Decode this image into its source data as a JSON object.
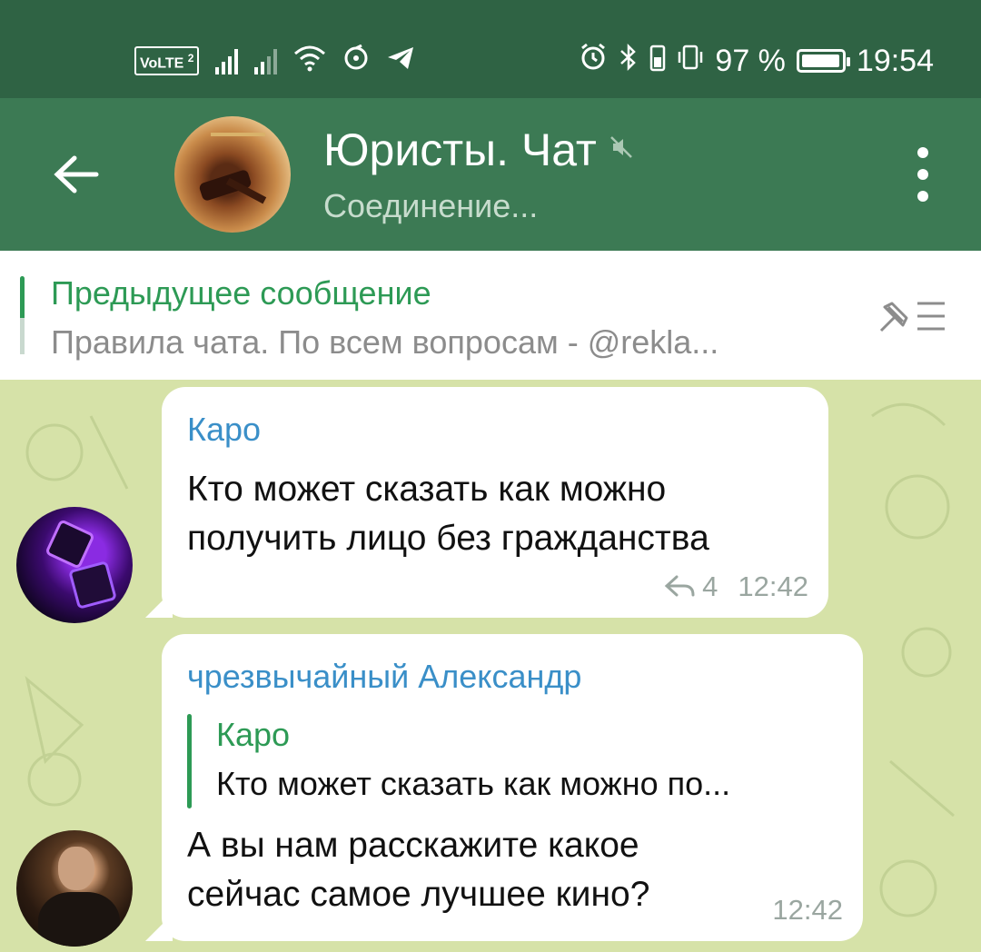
{
  "status_bar": {
    "volte_label": "VoLTE",
    "sim_number": "2",
    "battery_percent_label": "97 %",
    "battery_level": 0.97,
    "time": "19:54",
    "icons": [
      "signal-icon",
      "wifi-icon",
      "sync-icon",
      "telegram-icon",
      "alarm-icon",
      "bluetooth-icon",
      "vibrate-icon",
      "battery-icon"
    ]
  },
  "header": {
    "title": "Юристы. Чат",
    "status": "Соединение...",
    "colors": {
      "bar": "#3c7a54",
      "status_bar": "#2f6344"
    }
  },
  "pinned": {
    "title": "Предыдущее сообщение",
    "text": "Правила чата.  По всем вопросам - @rekla..."
  },
  "messages": [
    {
      "sender": "Каро",
      "text": "Кто может сказать как можно получить лицо без гражданства",
      "replies": "4",
      "time": "12:42"
    },
    {
      "sender": "чрезвычайный Александр",
      "reply_to": {
        "name": "Каро",
        "text": "Кто может сказать как можно по..."
      },
      "text": "А вы нам расскажите какое сейчас самое лучшее кино?",
      "time": "12:42"
    }
  ]
}
